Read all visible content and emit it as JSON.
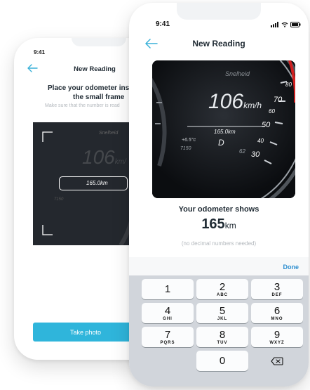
{
  "back_screen": {
    "time": "9:41",
    "title": "New Reading",
    "instruction_line1": "Place your odometer insi",
    "instruction_line2": "the small frame",
    "hint": "Make sure that the number is read",
    "take_photo_label": "Take photo",
    "dash": {
      "brand": "Snelheid",
      "speed": "106",
      "speed_unit": "km/",
      "odo": "165.0km",
      "temp": "7150"
    }
  },
  "front_screen": {
    "time": "9:41",
    "title": "New Reading",
    "dash": {
      "brand": "Snelheid",
      "speed": "106",
      "speed_unit": "km/h",
      "odo": "165.0km",
      "temp": "+6.5°c",
      "gear": "D",
      "trip": "7150",
      "misc": "62",
      "gauge_numbers": [
        "80",
        "70",
        "60",
        "50",
        "40",
        "30"
      ]
    },
    "result_label": "Your odometer shows",
    "result_value": "165",
    "result_unit": "km",
    "note": "(no decimal numbers needed)",
    "done_label": "Done",
    "keys": [
      {
        "digit": "1",
        "letters": ""
      },
      {
        "digit": "2",
        "letters": "ABC"
      },
      {
        "digit": "3",
        "letters": "DEF"
      },
      {
        "digit": "4",
        "letters": "GHI"
      },
      {
        "digit": "5",
        "letters": "JKL"
      },
      {
        "digit": "6",
        "letters": "MNO"
      },
      {
        "digit": "7",
        "letters": "PQRS"
      },
      {
        "digit": "8",
        "letters": "TUV"
      },
      {
        "digit": "9",
        "letters": "WXYZ"
      },
      {
        "digit": "0",
        "letters": ""
      }
    ]
  }
}
